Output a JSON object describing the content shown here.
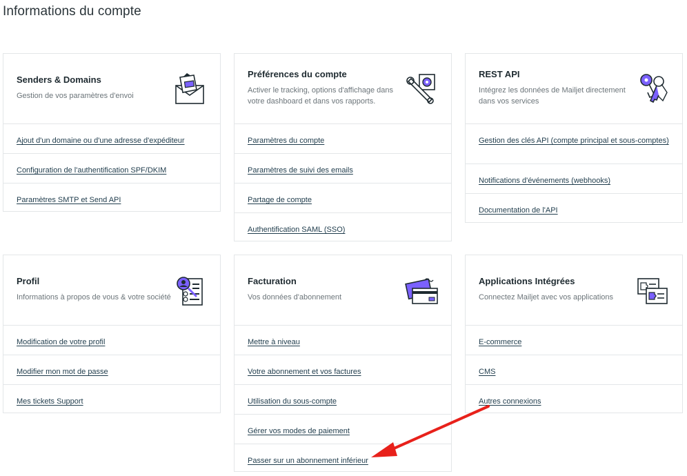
{
  "page": {
    "title": "Informations du compte"
  },
  "cards": [
    {
      "title": "Senders & Domains",
      "description": "Gestion de vos paramètres d'envoi",
      "icon": "envelope-illustration",
      "links": [
        "Ajout d'un domaine ou d'une adresse d'expéditeur",
        "Configuration de l'authentification SPF/DKIM",
        "Paramètres SMTP et Send API"
      ]
    },
    {
      "title": "Préférences du compte",
      "description": "Activer le tracking, options d'affichage dans votre dashboard et dans vos rapports.",
      "icon": "wrench-gear-illustration",
      "links": [
        "Paramètres du compte",
        "Paramètres de suivi des emails",
        "Partage de compte",
        "Authentification SAML (SSO)"
      ]
    },
    {
      "title": "REST API",
      "description": "Intégrez les données de Mailjet directement dans vos services",
      "icon": "keys-illustration",
      "links": [
        "Gestion des clés API (compte principal et sous-comptes)",
        "Notifications d'événements (webhooks)",
        "Documentation de l'API"
      ]
    },
    {
      "title": "Profil",
      "description": "Informations à propos de vous & votre société",
      "icon": "profile-magnifier-illustration",
      "links": [
        "Modification de votre profil",
        "Modifier mon mot de passe",
        "Mes tickets Support"
      ]
    },
    {
      "title": "Facturation",
      "description": "Vos données d'abonnement",
      "icon": "credit-card-illustration",
      "links": [
        "Mettre à niveau",
        "Votre abonnement et vos factures",
        "Utilisation du sous-compte",
        "Gérer vos modes de paiement",
        "Passer sur un abonnement inférieur"
      ]
    },
    {
      "title": "Applications Intégrées",
      "description": "Connectez Mailjet avec vos applications",
      "icon": "puzzle-cards-illustration",
      "links": [
        "E-commerce",
        "CMS",
        "Autres connexions"
      ]
    }
  ],
  "annotation": {
    "icon": "red-arrow-icon",
    "color": "#e8211b"
  },
  "colors": {
    "accent": "#7b61ff",
    "link": "#1e3b4b",
    "border": "#e3e6e8"
  }
}
